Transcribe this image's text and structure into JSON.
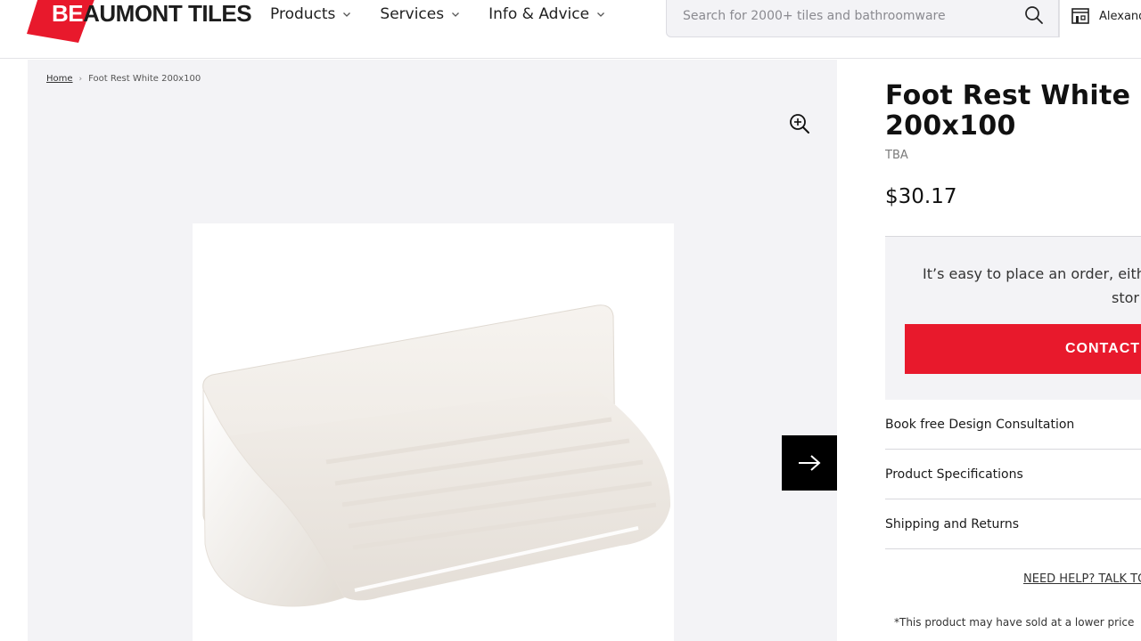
{
  "brand": {
    "name": "BEAUMONT TILES",
    "name_part1": "BE",
    "name_part2": "AUMONT TILES",
    "accent_color": "#e8192c"
  },
  "nav": {
    "items": [
      {
        "label": "Products",
        "icon": "chevron-down-icon"
      },
      {
        "label": "Services",
        "icon": "chevron-down-icon"
      },
      {
        "label": "Info & Advice",
        "icon": "chevron-down-icon"
      }
    ]
  },
  "search": {
    "placeholder": "Search for 2000+ tiles and bathroomware",
    "value": "",
    "icon": "search-icon"
  },
  "store": {
    "label": "Alexand",
    "icon": "store-icon"
  },
  "breadcrumb": {
    "home": "Home",
    "separator": "›",
    "current": "Foot Rest White 200x100"
  },
  "gallery": {
    "zoom_icon": "zoom-in-icon",
    "next_icon": "arrow-right-icon"
  },
  "product": {
    "title": "Foot Rest White 200x100",
    "sku": "TBA",
    "price": "$30.17"
  },
  "order": {
    "text_line1": "It’s easy to place an order, eith",
    "text_line2": "stor",
    "contact_button": "CONTACT A"
  },
  "accordion": [
    {
      "label": "Book free Design Consultation"
    },
    {
      "label": "Product Specifications"
    },
    {
      "label": "Shipping and Returns"
    }
  ],
  "help_link": "NEED HELP? TALK TO",
  "disclaimer": "*This product may have sold at a lower price"
}
